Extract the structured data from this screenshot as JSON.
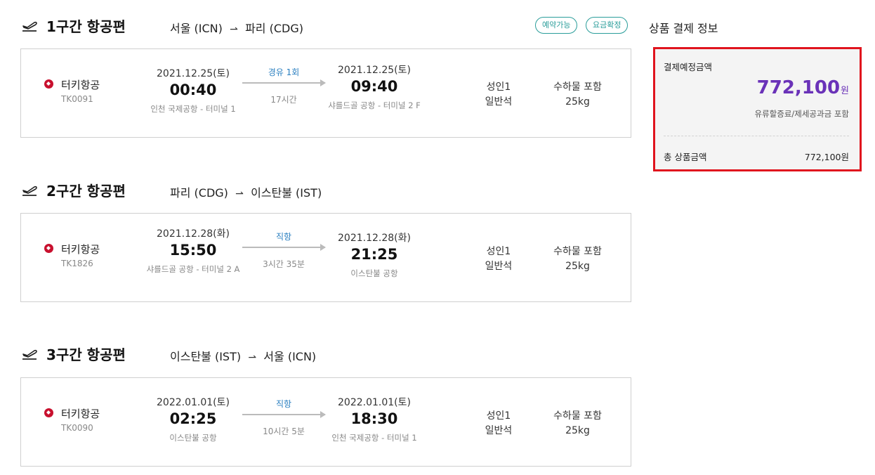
{
  "segments": [
    {
      "title": "1구간 항공편",
      "route_from": "서울 (ICN)",
      "route_to": "파리 (CDG)",
      "badges": [
        "예약가능",
        "요금확정"
      ],
      "airline": "터키항공",
      "flight_no": "TK0091",
      "dep_date": "2021.12.25(토)",
      "dep_time": "00:40",
      "dep_airport": "인천 국제공항 - 터미널 1",
      "stops": "경유 1회",
      "duration": "17시간",
      "arr_date": "2021.12.25(토)",
      "arr_time": "09:40",
      "arr_airport": "샤를드골 공항 - 터미널 2 F",
      "pax": "성인1",
      "cabin": "일반석",
      "baggage_label": "수하물 포함",
      "baggage_weight": "25kg"
    },
    {
      "title": "2구간 항공편",
      "route_from": "파리 (CDG)",
      "route_to": "이스탄불 (IST)",
      "airline": "터키항공",
      "flight_no": "TK1826",
      "dep_date": "2021.12.28(화)",
      "dep_time": "15:50",
      "dep_airport": "샤를드골 공항 - 터미널 2 A",
      "stops": "직항",
      "duration": "3시간 35분",
      "arr_date": "2021.12.28(화)",
      "arr_time": "21:25",
      "arr_airport": "이스탄불 공항",
      "pax": "성인1",
      "cabin": "일반석",
      "baggage_label": "수하물 포함",
      "baggage_weight": "25kg"
    },
    {
      "title": "3구간 항공편",
      "route_from": "이스탄불 (IST)",
      "route_to": "서울 (ICN)",
      "airline": "터키항공",
      "flight_no": "TK0090",
      "dep_date": "2022.01.01(토)",
      "dep_time": "02:25",
      "dep_airport": "이스탄불 공항",
      "stops": "직항",
      "duration": "10시간 5분",
      "arr_date": "2022.01.01(토)",
      "arr_time": "18:30",
      "arr_airport": "인천 국제공항 - 터미널 1",
      "pax": "성인1",
      "cabin": "일반석",
      "baggage_label": "수하물 포함",
      "baggage_weight": "25kg"
    }
  ],
  "icons": {
    "segment": "plane-takeoff-icon",
    "airline_logo": "turkish-airlines-logo"
  },
  "summary": {
    "title": "상품 결제 정보",
    "expected_label": "결제예정금액",
    "amount": "772,100",
    "currency": "원",
    "note": "유류할증료/제세공과금 포함",
    "total_label": "총 상품금액",
    "total_value": "772,100원"
  },
  "colors": {
    "accent_purple": "#6a32b8",
    "highlight_red": "#e0141e",
    "badge_teal": "#2a9d9a",
    "stops_blue": "#2a7fc0",
    "airline_red": "#c8102e"
  }
}
